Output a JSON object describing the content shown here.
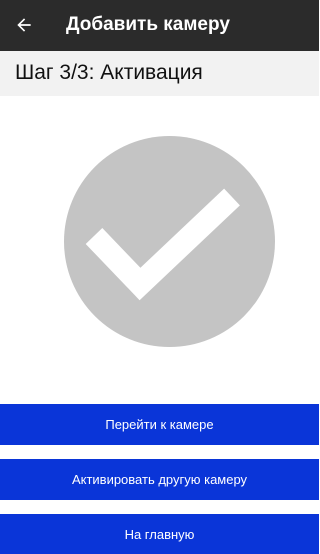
{
  "app_bar": {
    "title": "Добавить камеру",
    "back_icon": "arrow-left-icon",
    "background_color": "#2b2b2b"
  },
  "step": {
    "title": "Шаг 3/3: Активация",
    "background_color": "#f2f2f2"
  },
  "status": {
    "icon": "checkmark-circle-icon",
    "circle_color": "#c4c4c4",
    "check_color": "#ffffff"
  },
  "actions": {
    "go_to_camera_label": "Перейти к камере",
    "activate_another_label": "Активировать другую камеру",
    "home_label": "На главную",
    "button_color": "#0a35d8"
  }
}
